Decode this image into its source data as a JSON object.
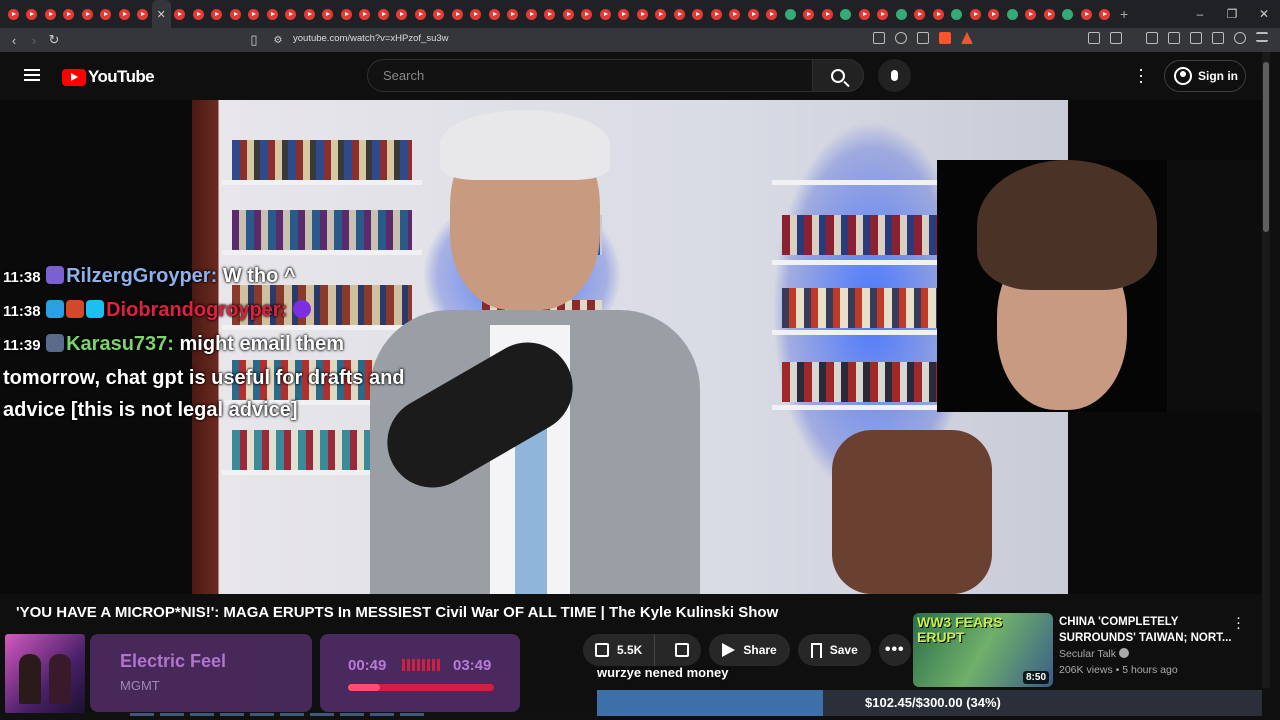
{
  "browser": {
    "url": "youtube.com/watch?v=xHPzof_su3w",
    "new_tab_label": "+",
    "window_controls": [
      "–",
      "❐",
      "✕"
    ]
  },
  "header": {
    "logo_text": "YouTube",
    "search_placeholder": "Search",
    "signin_label": "Sign in"
  },
  "chat": [
    {
      "time": "11:38",
      "user": "RilzergGroyper",
      "message": "W tho ^",
      "color": "#8fb0e8"
    },
    {
      "time": "11:38",
      "user": "Diobrandogroyper",
      "message": "",
      "color": "#e0213f"
    },
    {
      "time": "11:39",
      "user": "Karasu737",
      "message": "might email them tomorrow, chat gpt is useful for drafts and advice [this is not legal advice]",
      "color": "#7bd36b"
    }
  ],
  "video": {
    "title": "'YOU HAVE A MICROP*NIS!': MAGA ERUPTS In MESSIEST Civil War OF ALL TIME | The Kyle Kulinski Show",
    "likes": "5.5K",
    "share_label": "Share",
    "save_label": "Save",
    "more_label": "•••"
  },
  "now_playing": {
    "song": "Electric Feel",
    "artist": "MGMT",
    "current_time": "00:49",
    "total_time": "03:49",
    "progress_fraction": 0.22
  },
  "ticker_text": "wurzye nened money",
  "donation_goal": {
    "text": "$102.45/$300.00 (34%)",
    "fraction": 0.34
  },
  "recommended": {
    "thumb_text": "WW3 FEARS ERUPT",
    "duration": "8:50",
    "title": "CHINA 'COMPLETELY SURROUNDS' TAIWAN; NORT...",
    "channel": "Secular Talk",
    "views": "206K views",
    "age": "5 hours ago"
  }
}
